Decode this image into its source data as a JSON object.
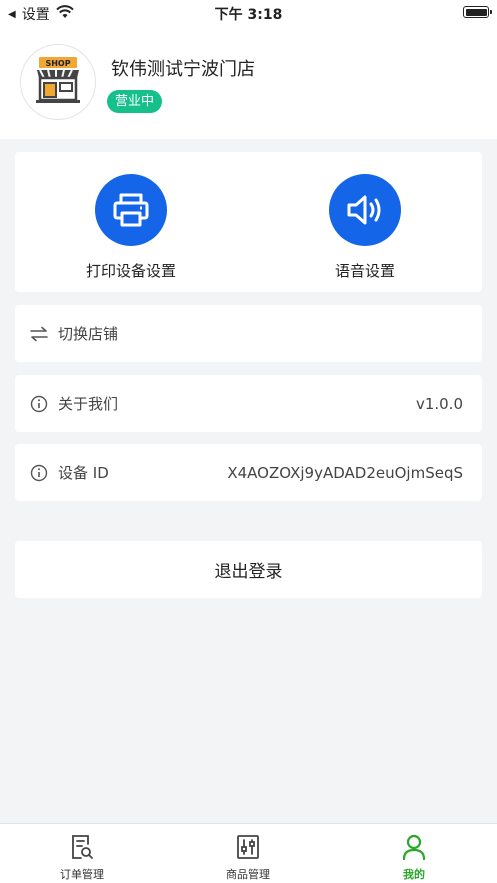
{
  "status_bar": {
    "back_label": "设置",
    "time": "下午 3:18",
    "back_icon": "back-triangle-icon",
    "signal_icon": "wifi-icon",
    "battery_icon": "battery-icon"
  },
  "header": {
    "avatar_icon": "shop-icon",
    "avatar_text": "SHOP",
    "store_name": "钦伟测试宁波门店",
    "status": "营业中",
    "status_color": "#15c08a"
  },
  "quick_actions": [
    {
      "label": "打印设备设置",
      "icon": "printer-icon"
    },
    {
      "label": "语音设置",
      "icon": "speaker-icon"
    }
  ],
  "accent_color": "#1465e8",
  "menu": {
    "switch_store": {
      "label": "切换店铺",
      "icon": "swap-icon"
    },
    "about": {
      "label": "关于我们",
      "value": "v1.0.0",
      "icon": "info-icon"
    },
    "device_id": {
      "label": "设备 ID",
      "value": "X4AOZOXj9yADAD2euOjmSeqS",
      "icon": "info-icon"
    }
  },
  "logout_label": "退出登录",
  "tabbar": {
    "active_color": "#2aa82a",
    "items": [
      {
        "label": "订单管理",
        "icon": "order-search-icon",
        "active": false
      },
      {
        "label": "商品管理",
        "icon": "product-sliders-icon",
        "active": false
      },
      {
        "label": "我的",
        "icon": "person-icon",
        "active": true
      }
    ]
  }
}
